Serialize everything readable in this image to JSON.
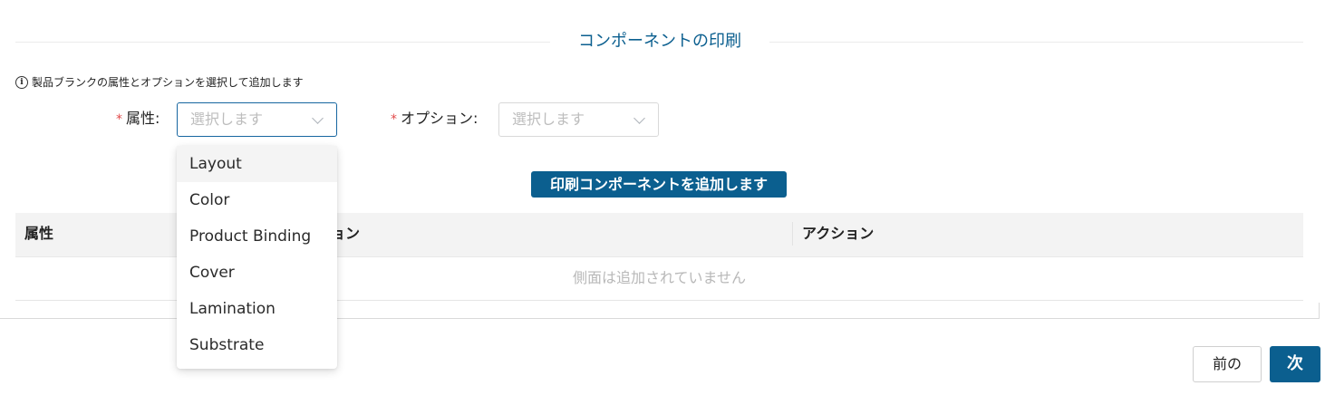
{
  "section": {
    "title": "コンポーネントの印刷"
  },
  "hint": {
    "text": "製品ブランクの属性とオプションを選択して追加します"
  },
  "form": {
    "attribute_label": "属性",
    "attribute_placeholder": "選択します",
    "option_label": "オプション",
    "option_placeholder": "選択します",
    "colon": ":"
  },
  "dropdown": {
    "options": [
      "Layout",
      "Color",
      "Product Binding",
      "Cover",
      "Lamination",
      "Substrate"
    ],
    "highlighted": "Layout"
  },
  "add_button": {
    "label": "印刷コンポーネントを追加します"
  },
  "table": {
    "columns": [
      "属性",
      "オプション",
      "アクション"
    ],
    "empty_text": "側面は追加されていません"
  },
  "footer": {
    "prev_label": "前の",
    "next_label": "次"
  },
  "colors": {
    "accent": "#0b5f8f",
    "required": "#e24a4a"
  }
}
